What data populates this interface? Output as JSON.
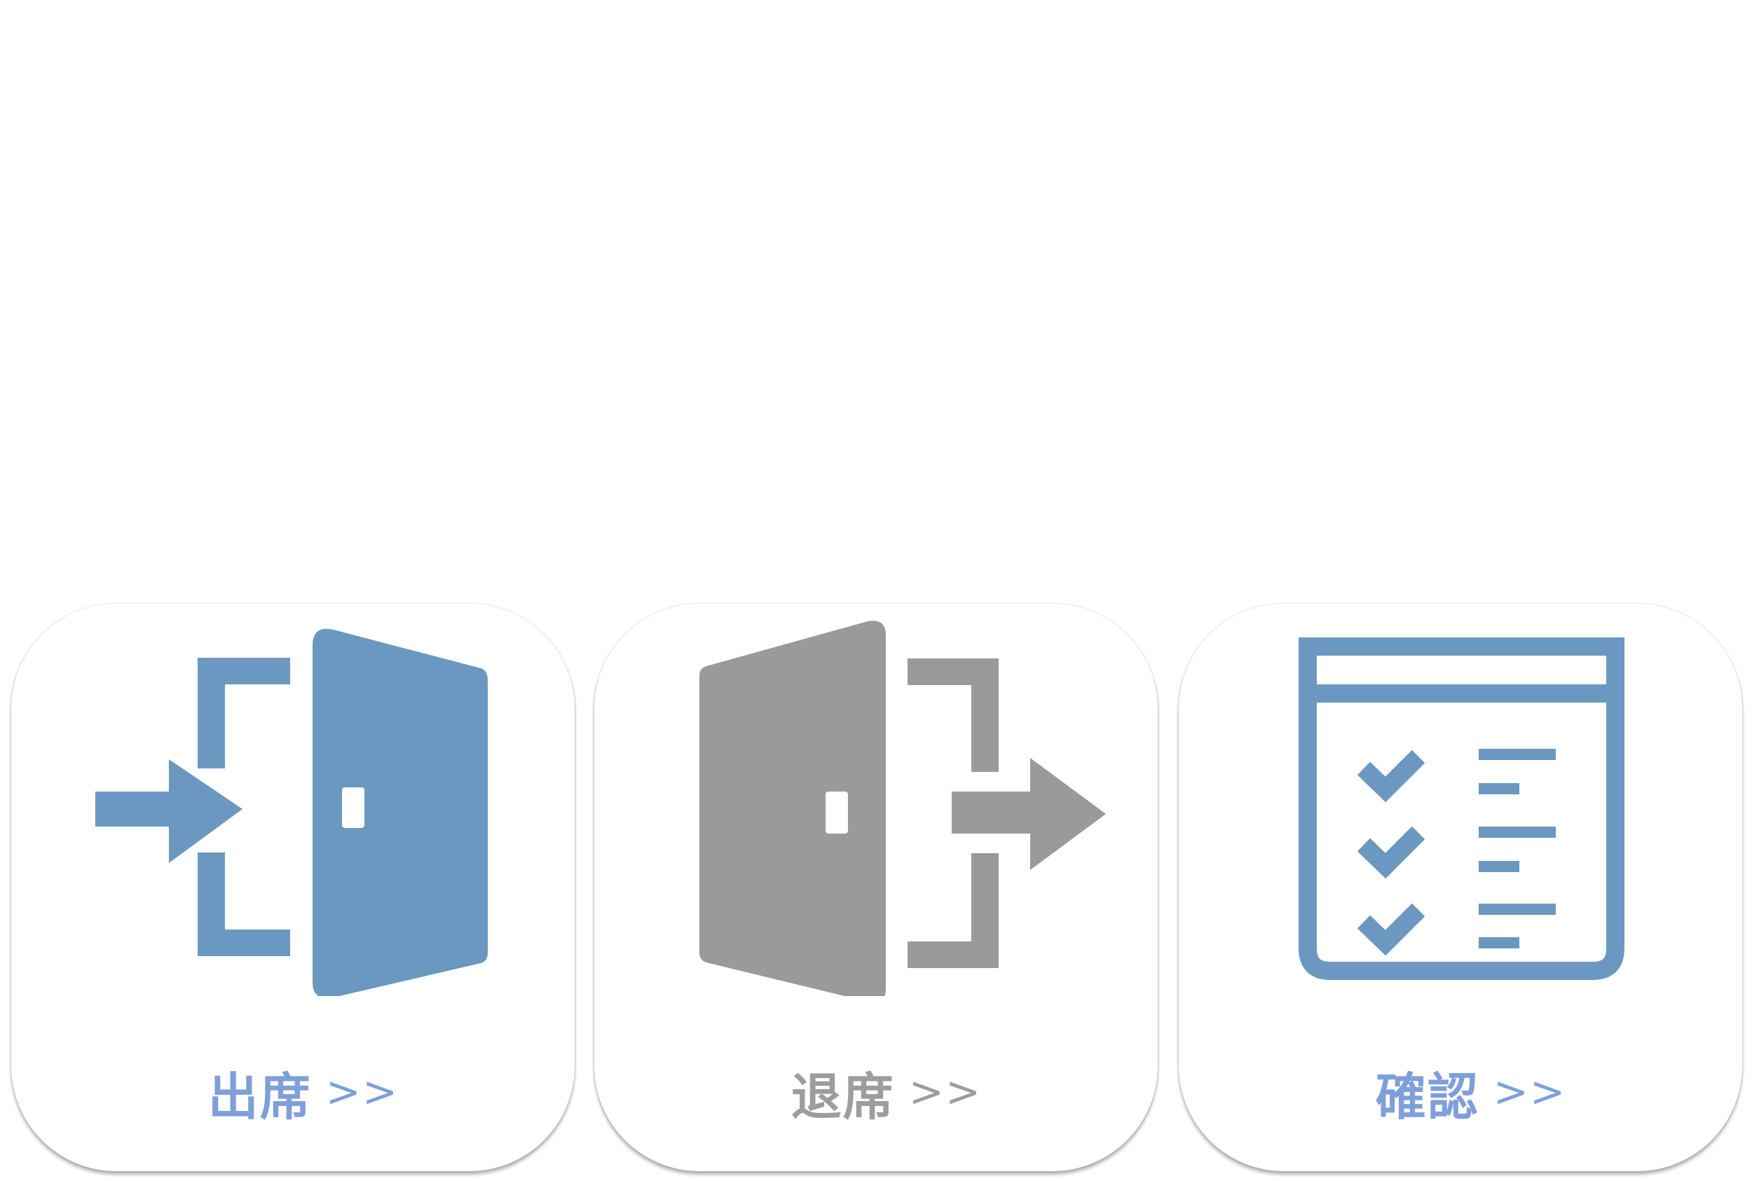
{
  "colors": {
    "blue": "#6b98c0",
    "gray": "#9a9a9a",
    "label_blue": "#7f9fdb",
    "label_gray": "#9d9d9d"
  },
  "tiles": [
    {
      "label": "出席",
      "arrow": ">>",
      "icon": "enter-door-icon",
      "color": "blue"
    },
    {
      "label": "退席",
      "arrow": ">>",
      "icon": "exit-door-icon",
      "color": "gray"
    },
    {
      "label": "確認",
      "arrow": ">>",
      "icon": "checklist-icon",
      "color": "blue"
    }
  ]
}
